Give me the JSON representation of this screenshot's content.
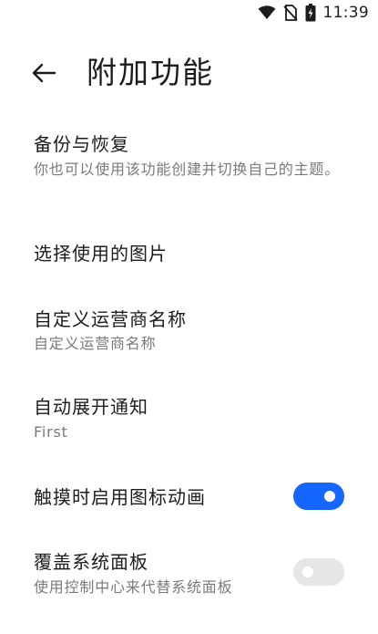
{
  "status_bar": {
    "time": "11:39",
    "icons": [
      "wifi-icon",
      "no-sim-icon",
      "battery-icon"
    ]
  },
  "header": {
    "title": "附加功能",
    "back_icon": "arrow-left-icon"
  },
  "settings": {
    "backup": {
      "title": "备份与恢复",
      "summary": "你也可以使用该功能创建并切换自己的主题。"
    },
    "choose_image": {
      "title": "选择使用的图片"
    },
    "carrier_name": {
      "title": "自定义运营商名称",
      "summary": "自定义运营商名称"
    },
    "auto_expand": {
      "title": "自动展开通知",
      "summary": "First"
    },
    "icon_animation": {
      "title": "触摸时启用图标动画",
      "enabled": true
    },
    "override_panel": {
      "title": "覆盖系统面板",
      "summary": "使用控制中心来代替系统面板",
      "enabled": false
    }
  },
  "colors": {
    "accent": "#1565ff",
    "toggle_off": "#e6e6e8",
    "summary_text": "#7a7a7e",
    "title_text": "#1c1c1e"
  }
}
